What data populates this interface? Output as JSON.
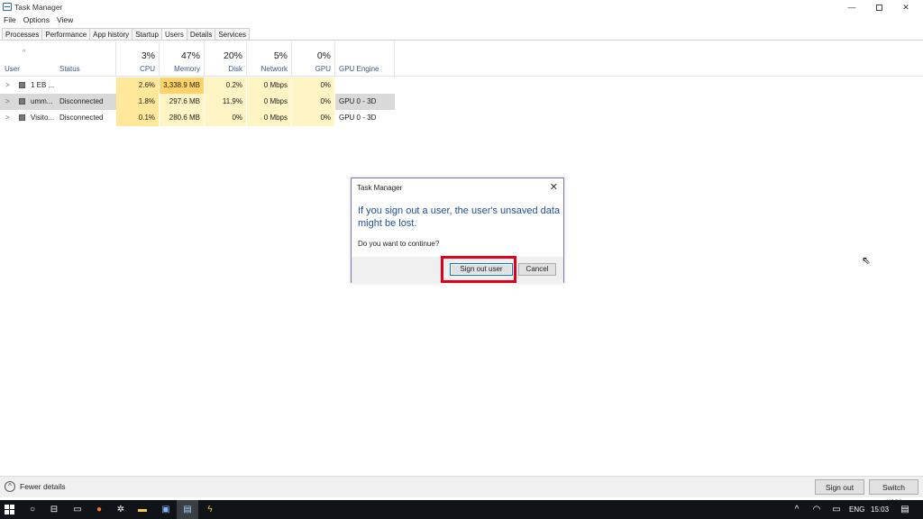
{
  "window": {
    "title": "Task Manager",
    "controls": {
      "minimize": "—",
      "close": "✕"
    }
  },
  "menu": [
    "File",
    "Options",
    "View"
  ],
  "tabs": [
    {
      "label": "Processes",
      "active": false
    },
    {
      "label": "Performance",
      "active": false
    },
    {
      "label": "App history",
      "active": false
    },
    {
      "label": "Startup",
      "active": false
    },
    {
      "label": "Users",
      "active": true
    },
    {
      "label": "Details",
      "active": false
    },
    {
      "label": "Services",
      "active": false
    }
  ],
  "table": {
    "sort_glyph": "^",
    "columns": {
      "user": "User",
      "status": "Status",
      "cpu": {
        "label": "CPU",
        "pct": "3%"
      },
      "memory": {
        "label": "Memory",
        "pct": "47%"
      },
      "disk": {
        "label": "Disk",
        "pct": "20%"
      },
      "network": {
        "label": "Network",
        "pct": "5%"
      },
      "gpu": {
        "label": "GPU",
        "pct": "0%"
      },
      "gpu_engine": "GPU Engine"
    },
    "rows": [
      {
        "user": "1 EB ...",
        "status": "",
        "cpu": "2.6%",
        "memory": "3,338.9 MB",
        "disk": "0.2%",
        "network": "0 Mbps",
        "gpu": "0%",
        "gpu_engine": ""
      },
      {
        "user": "umm...",
        "status": "Disconnected",
        "cpu": "1.8%",
        "memory": "297.6 MB",
        "disk": "11.9%",
        "network": "0 Mbps",
        "gpu": "0%",
        "gpu_engine": "GPU 0 - 3D"
      },
      {
        "user": "Visito...",
        "status": "Disconnected",
        "cpu": "0.1%",
        "memory": "280.6 MB",
        "disk": "0%",
        "network": "0 Mbps",
        "gpu": "0%",
        "gpu_engine": "GPU 0 - 3D"
      }
    ],
    "expand_glyph": ">"
  },
  "dialog": {
    "title": "Task Manager",
    "close_glyph": "✕",
    "main_instruction": "If you sign out a user, the user's unsaved data might be lost.",
    "question": "Do you want to continue?",
    "primary_button": "Sign out user",
    "secondary_button": "Cancel"
  },
  "bottom": {
    "fewer_details": "Fewer details",
    "sign_out": "Sign out",
    "switch_user": "Switch user"
  },
  "taskbar": {
    "language": "ENG",
    "time": "15:03"
  },
  "colors": {
    "heat_low": "#fff4c4",
    "heat_mid": "#ffe89a",
    "heat_high": "#ffd369",
    "highlight": "#e0001a",
    "dialog_text": "#1e4fa0"
  }
}
